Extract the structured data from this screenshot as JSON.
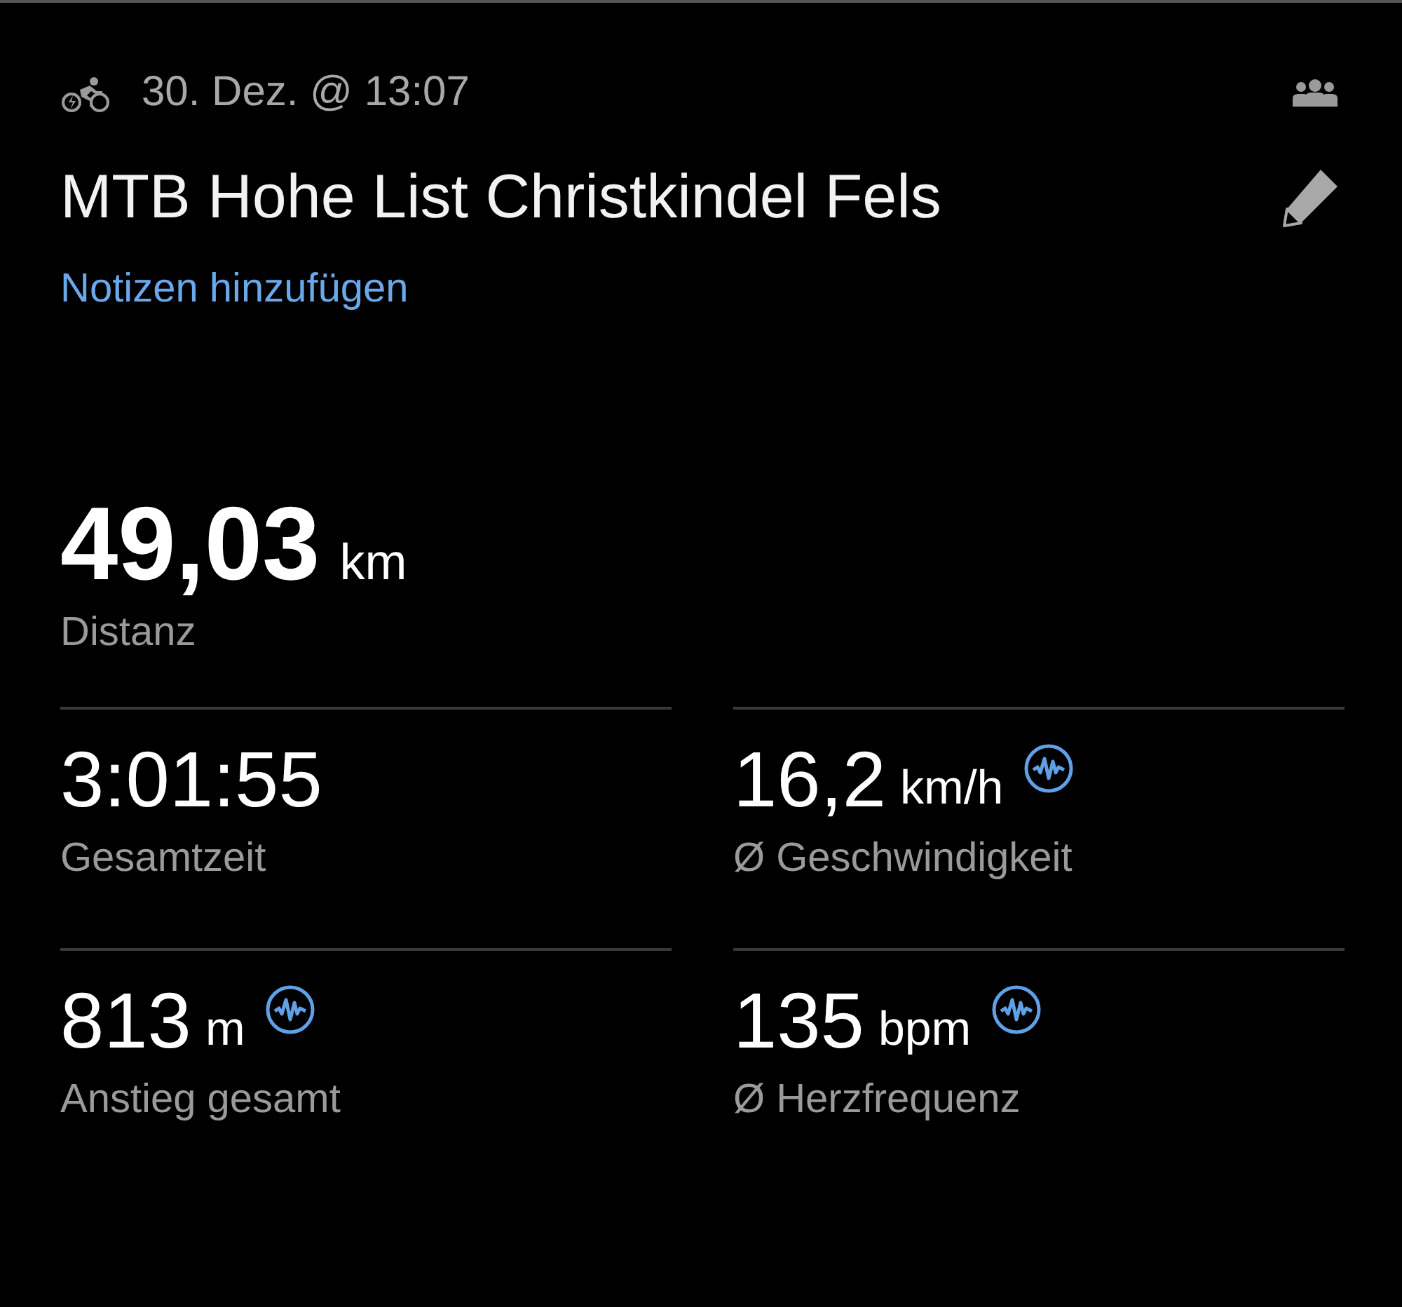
{
  "header": {
    "date": "30. Dez. @ 13:07"
  },
  "title": "MTB Hohe List Christkindel Fels",
  "notes_link": "Notizen hinzufügen",
  "main_stat": {
    "value": "49,03",
    "unit": "km",
    "label": "Distanz"
  },
  "stats": [
    {
      "value": "3:01:55",
      "label": "Gesamtzeit",
      "trend_icon": false
    },
    {
      "value": "16,2",
      "unit": "km/h",
      "label": "Ø Geschwindigkeit",
      "trend_icon": true
    },
    {
      "value": "813",
      "unit": "m",
      "label": "Anstieg gesamt",
      "trend_icon": true
    },
    {
      "value": "135",
      "unit": "bpm",
      "label": "Ø Herzfrequenz",
      "trend_icon": true
    }
  ]
}
